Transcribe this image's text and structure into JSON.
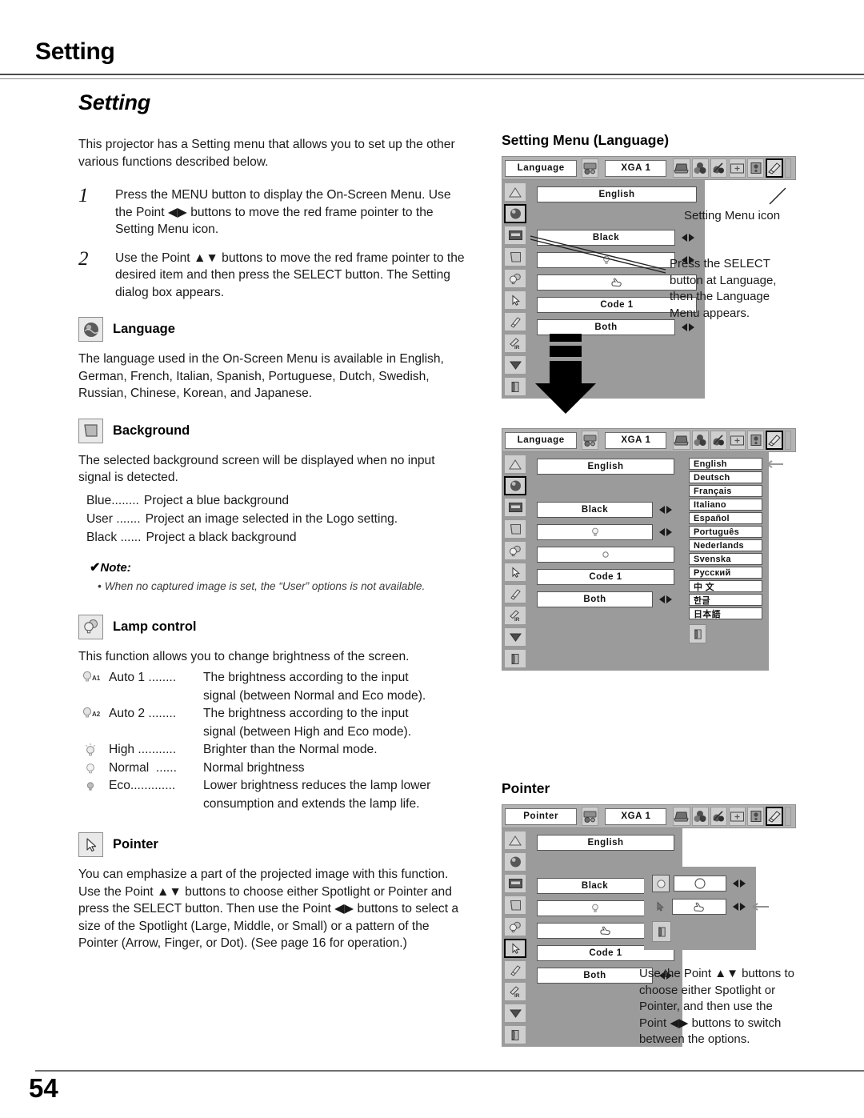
{
  "running_head": "Setting",
  "page_number": "54",
  "left": {
    "section_title": "Setting",
    "intro": "This projector has a Setting menu that allows you to set up the other various functions described below.",
    "steps": [
      {
        "num": "1",
        "text": "Press the MENU button to display the On-Screen Menu. Use the Point ◀▶ buttons to move the red frame pointer to the Setting Menu icon."
      },
      {
        "num": "2",
        "text": "Use the Point ▲▼ buttons to move the red frame pointer to the desired item and then press the SELECT button. The Setting dialog box appears."
      }
    ],
    "language": {
      "heading": "Language",
      "icon": "globe-icon",
      "body": "The language used in the On-Screen Menu is available in English, German, French, Italian, Spanish, Portuguese, Dutch, Swedish, Russian, Chinese, Korean, and Japanese."
    },
    "background": {
      "heading": "Background",
      "icon": "background-screen-icon",
      "body": "The selected background screen will be displayed when no input signal is detected.",
      "options": [
        {
          "key": "Blue........",
          "value": "Project a blue background"
        },
        {
          "key": "User .......",
          "value": "Project an image selected in the Logo setting."
        },
        {
          "key": "Black ......",
          "value": "Project a black background"
        }
      ],
      "note_label": "Note:",
      "note_items": [
        "When no captured image is set, the “User” options is not available."
      ]
    },
    "lamp": {
      "heading": "Lamp control",
      "icon": "lamp-icon",
      "body": "This function allows you to change brightness of the screen.",
      "options": [
        {
          "icon": "bulb-a1-icon",
          "key": "Auto 1 ........",
          "value": "The brightness according to the input",
          "cont": "signal (between Normal and Eco mode)."
        },
        {
          "icon": "bulb-a2-icon",
          "key": "Auto 2 ........",
          "value": "The brightness according to the input",
          "cont": "signal (between High and Eco mode)."
        },
        {
          "icon": "bulb-high-icon",
          "key": "High ...........",
          "value": "Brighter than the Normal mode.",
          "cont": ""
        },
        {
          "icon": "bulb-normal-icon",
          "key": "Normal  ......",
          "value": "Normal brightness",
          "cont": ""
        },
        {
          "icon": "bulb-eco-icon",
          "key": "Eco.............",
          "value": "Lower brightness reduces the lamp lower",
          "cont": "consumption and extends the lamp life."
        }
      ]
    },
    "pointer": {
      "heading": "Pointer",
      "icon": "pointer-arrow-icon",
      "body": "You can emphasize a part of the projected image with this function. Use the Point ▲▼ buttons to choose either Spotlight or Pointer and press the SELECT button. Then use the Point ◀▶ buttons to select a size of the Spotlight (Large, Middle, or Small) or a pattern of the Pointer (Arrow, Finger, or Dot). (See page 16 for operation.)"
    }
  },
  "right": {
    "language_menu": {
      "heading": "Setting Menu (Language)",
      "osd": {
        "title_field": "Language",
        "source_field": "XGA 1",
        "top_icons": [
          "input-icon",
          "color-adjust-icon",
          "image-adjust-icon",
          "screen-icon",
          "sound-icon",
          "setting-icon"
        ],
        "selected_top_icon": "setting-icon",
        "rail_icons": [
          "keystone-icon",
          "language-globe-icon",
          "logo-icon",
          "background-icon",
          "lamp-icon",
          "pointer-icon",
          "remote-code-icon",
          "ir-receiver-icon",
          "scroll-down-icon",
          "quit-icon"
        ],
        "selected_rail_icon": "language-globe-icon",
        "rows": [
          {
            "value": "English",
            "arrows": false,
            "icon": ""
          },
          {
            "value": "Black",
            "arrows": true,
            "icon": ""
          },
          {
            "value": "",
            "arrows": true,
            "icon": "bulb-normal-icon"
          },
          {
            "value": "",
            "arrows": false,
            "icon": "hand-pointer-icon"
          },
          {
            "value": "Code 1",
            "arrows": false,
            "icon": ""
          },
          {
            "value": "Both",
            "arrows": true,
            "icon": ""
          }
        ]
      },
      "callout_icon": "Setting Menu icon",
      "callout_select": "Press the SELECT button at Language, then the Language Menu appears."
    },
    "language_list_menu": {
      "osd": {
        "title_field": "Language",
        "source_field": "XGA 1",
        "rows": [
          {
            "value": "English",
            "arrows": false,
            "icon": ""
          },
          {
            "value": "Black",
            "arrows": true,
            "icon": ""
          },
          {
            "value": "",
            "arrows": true,
            "icon": "bulb-normal-icon"
          },
          {
            "value": "",
            "arrows": false,
            "icon": "dot-icon"
          },
          {
            "value": "Code 1",
            "arrows": false,
            "icon": ""
          },
          {
            "value": "Both",
            "arrows": true,
            "icon": ""
          }
        ],
        "languages": [
          "English",
          "Deutsch",
          "Français",
          "Italiano",
          "Español",
          "Português",
          "Nederlands",
          "Svenska",
          "Русский",
          "中 文",
          "한글",
          "日本語"
        ],
        "selected_language": "English",
        "quit_icon": "quit-icon"
      }
    },
    "pointer_menu": {
      "heading": "Pointer",
      "osd": {
        "title_field": "Pointer",
        "source_field": "XGA 1",
        "rows": [
          {
            "value": "English",
            "arrows": false,
            "icon": ""
          },
          {
            "value": "Black",
            "arrows": true,
            "icon": ""
          },
          {
            "value": "",
            "arrows": true,
            "icon": "bulb-normal-icon"
          },
          {
            "value": "",
            "arrows": false,
            "icon": "hand-pointer-icon"
          },
          {
            "value": "Code 1",
            "arrows": false,
            "icon": ""
          },
          {
            "value": "Both",
            "arrows": true,
            "icon": ""
          }
        ],
        "selected_rail_icon": "pointer-icon",
        "dialog_rows": [
          {
            "icon": "spotlight-icon",
            "value": "spotlight-circle",
            "arrows": true,
            "marker": false
          },
          {
            "icon": "hand-pointer-icon",
            "value": "hand-pointer",
            "arrows": true,
            "marker": true
          }
        ],
        "quit_icon": "quit-icon"
      },
      "callout": "Use the Point ▲▼ buttons to choose either Spotlight or Pointer, and then use the Point ◀▶ buttons to switch between the options."
    }
  }
}
